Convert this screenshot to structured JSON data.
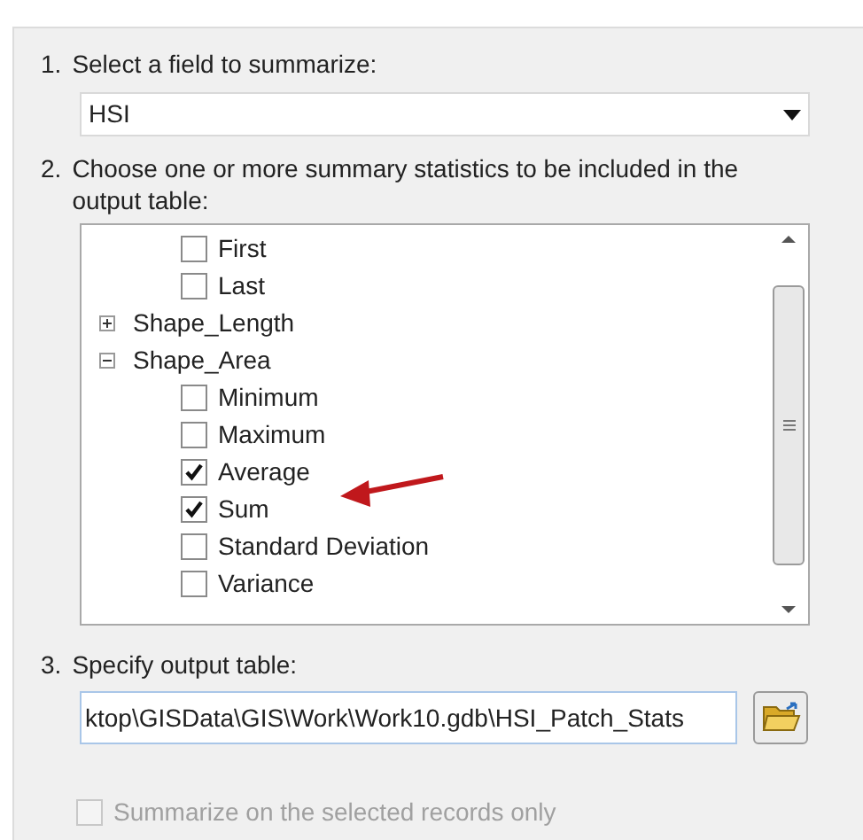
{
  "steps": [
    {
      "number": "1.",
      "label": "Select a field to summarize:"
    },
    {
      "number": "2.",
      "label": "Choose one or more summary statistics to be included in the output table:"
    },
    {
      "number": "3.",
      "label": "Specify output table:"
    }
  ],
  "field_select": {
    "value": "HSI"
  },
  "statistics_tree": [
    {
      "kind": "stat",
      "label": "First",
      "checked": false
    },
    {
      "kind": "stat",
      "label": "Last",
      "checked": false
    },
    {
      "kind": "field",
      "label": "Shape_Length",
      "expanded": false
    },
    {
      "kind": "field",
      "label": "Shape_Area",
      "expanded": true,
      "children": [
        {
          "kind": "stat",
          "label": "Minimum",
          "checked": false
        },
        {
          "kind": "stat",
          "label": "Maximum",
          "checked": false
        },
        {
          "kind": "stat",
          "label": "Average",
          "checked": true
        },
        {
          "kind": "stat",
          "label": "Sum",
          "checked": true
        },
        {
          "kind": "stat",
          "label": "Standard Deviation",
          "checked": false
        },
        {
          "kind": "stat",
          "label": "Variance",
          "checked": false
        }
      ]
    }
  ],
  "output_table": {
    "value": "ktop\\GISData\\GIS\\Work\\Work10.gdb\\HSI_Patch_Stats"
  },
  "selected_only": {
    "label": "Summarize on the selected records only",
    "checked": false,
    "disabled": true
  }
}
